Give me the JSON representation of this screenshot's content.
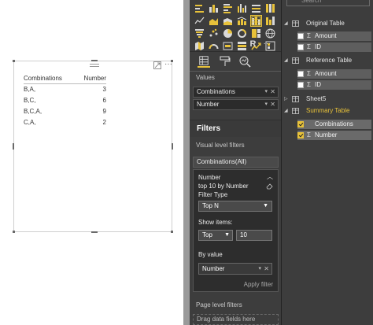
{
  "canvas": {
    "table": {
      "columns": [
        "Combinations",
        "Number"
      ],
      "rows": [
        {
          "combination": "B,A,",
          "number": "3"
        },
        {
          "combination": "B,C,",
          "number": "6"
        },
        {
          "combination": "B,C,A,",
          "number": "9"
        },
        {
          "combination": "C,A,",
          "number": "2"
        }
      ]
    },
    "more_label": "···"
  },
  "visualizations": {
    "icons": [
      "stacked-bar-chart-icon",
      "stacked-column-chart-icon",
      "clustered-bar-chart-icon",
      "clustered-column-chart-icon",
      "100-percent-bar-chart-icon",
      "100-percent-column-chart-icon",
      "line-chart-icon",
      "area-chart-icon",
      "stacked-area-chart-icon",
      "line-column-chart-icon",
      "ribbon-chart-icon",
      "waterfall-chart-icon",
      "funnel-chart-icon",
      "scatter-chart-icon",
      "pie-chart-icon",
      "donut-chart-icon",
      "treemap-icon",
      "map-icon",
      "filled-map-icon",
      "gauge-icon",
      "card-icon",
      "multi-row-card-icon",
      "kpi-icon",
      "slicer-icon",
      "table-icon",
      "matrix-icon",
      "r-visual-icon",
      "more-visuals-icon"
    ],
    "selected_icon": "table-icon",
    "r_glyph": "R",
    "values_label": "Values",
    "value_wells": [
      "Combinations",
      "Number"
    ],
    "filters_title": "Filters",
    "visual_level_filters_label": "Visual level filters",
    "filter_combinations": "Combinations(All)",
    "filter_card": {
      "field_name": "Number",
      "summary": "top 10 by Number",
      "filter_type_label": "Filter Type",
      "filter_type_value": "Top N",
      "show_items_label": "Show items:",
      "show_items_direction": "Top",
      "show_items_count": "10",
      "by_value_label": "By value",
      "by_value_field": "Number",
      "apply_label": "Apply filter"
    },
    "page_level_filters_label": "Page level filters",
    "drag_hint": "Drag data fields here"
  },
  "fields": {
    "search_placeholder": "Search",
    "tables": [
      {
        "name": "Original Table",
        "fields": [
          {
            "name": "Amount",
            "sigma": true,
            "checked": false
          },
          {
            "name": "ID",
            "sigma": true,
            "checked": false
          }
        ]
      },
      {
        "name": "Reference Table",
        "fields": [
          {
            "name": "Amount",
            "sigma": true,
            "checked": false
          },
          {
            "name": "ID",
            "sigma": true,
            "checked": false
          }
        ]
      },
      {
        "name": "Sheet5",
        "fields": []
      },
      {
        "name": "Summary Table",
        "fields": [
          {
            "name": "Combinations",
            "sigma": false,
            "checked": true
          },
          {
            "name": "Number",
            "sigma": true,
            "checked": true
          }
        ]
      }
    ],
    "sigma_glyph": "Σ"
  },
  "colors": {
    "accent_yellow": "#e8c23a",
    "pane_dark": "#3d3d3d",
    "canvas_white": "#ffffff"
  }
}
